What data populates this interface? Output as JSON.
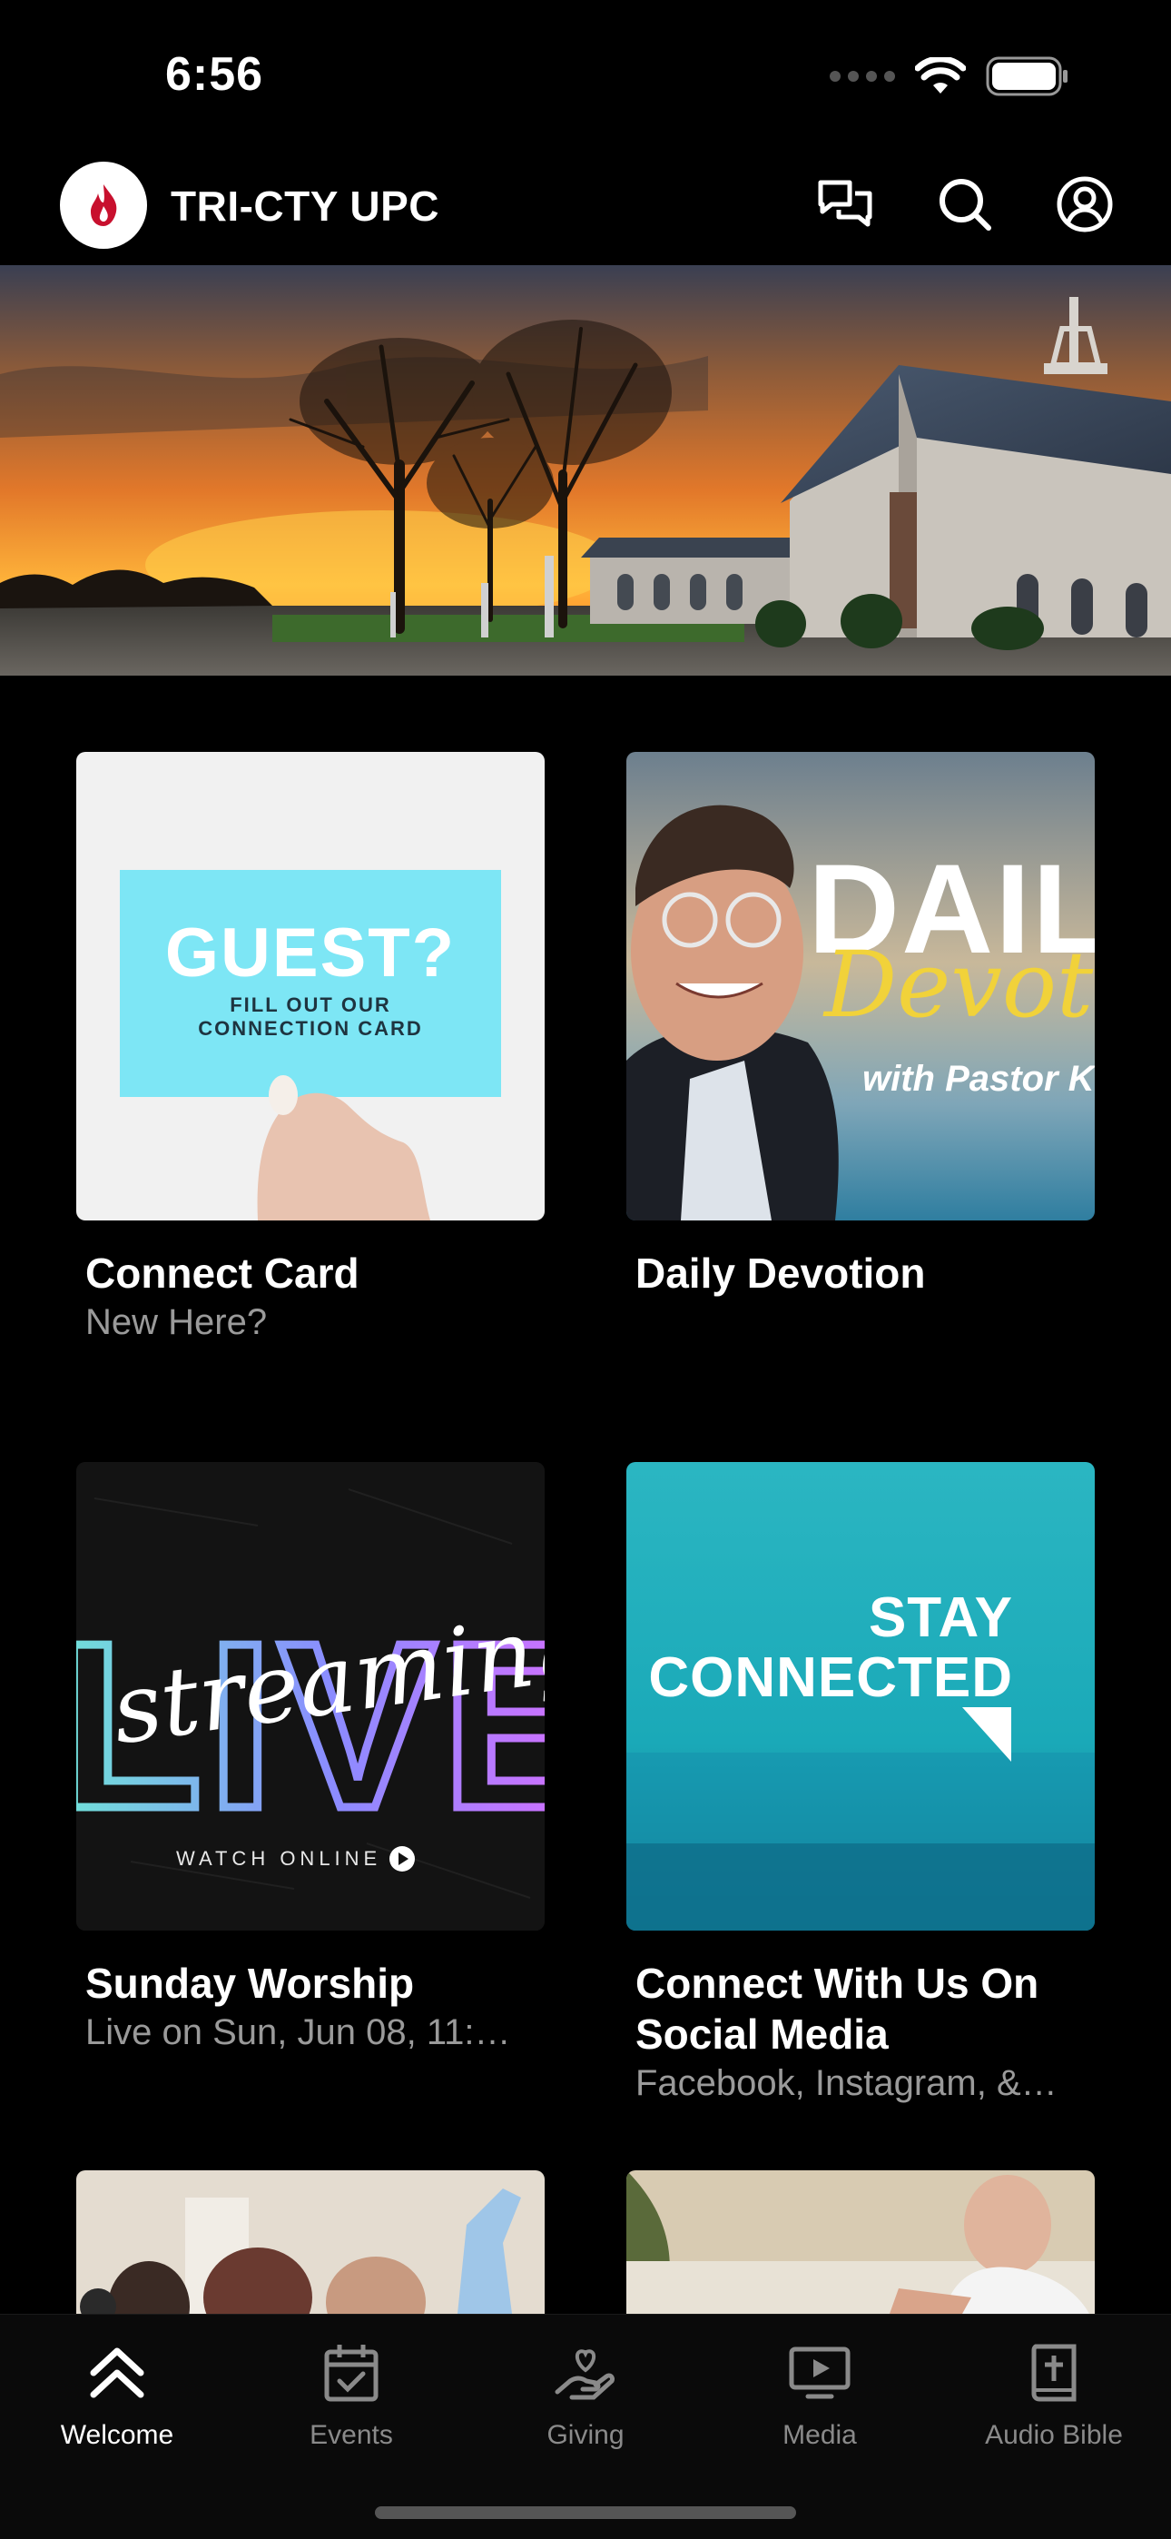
{
  "status": {
    "time": "6:56"
  },
  "header": {
    "title": "TRI-CTY UPC"
  },
  "tiles": [
    {
      "title": "Connect Card",
      "subtitle": "New Here?",
      "art": {
        "big": "GUEST?",
        "line1": "FILL OUT OUR",
        "line2": "CONNECTION CARD"
      }
    },
    {
      "title": "Daily Devotion",
      "subtitle": "",
      "art": {
        "big": "DAIL",
        "script": "Devot",
        "byline": "with Pastor Ken"
      }
    },
    {
      "title": "Sunday Worship",
      "subtitle": "Live on Sun, Jun 08, 11:…",
      "art": {
        "big": "LIVE",
        "script": "streaming",
        "caption": "WATCH ONLINE"
      }
    },
    {
      "title": "Connect With Us On Social Media",
      "subtitle": "Facebook, Instagram, &…",
      "art": {
        "line1": "STAY",
        "line2": "CONNECTED"
      }
    }
  ],
  "tabs": [
    {
      "label": "Welcome",
      "icon": "double-chevron-up-icon",
      "active": true
    },
    {
      "label": "Events",
      "icon": "calendar-check-icon",
      "active": false
    },
    {
      "label": "Giving",
      "icon": "hand-heart-icon",
      "active": false
    },
    {
      "label": "Media",
      "icon": "monitor-play-icon",
      "active": false
    },
    {
      "label": "Audio Bible",
      "icon": "bible-icon",
      "active": false
    }
  ],
  "colors": {
    "background": "#000000",
    "accent": "#c8102e",
    "tab_inactive": "#8a8a8a",
    "guest_card": "#7de6f5",
    "stay_connected": "#1aa9b8"
  }
}
